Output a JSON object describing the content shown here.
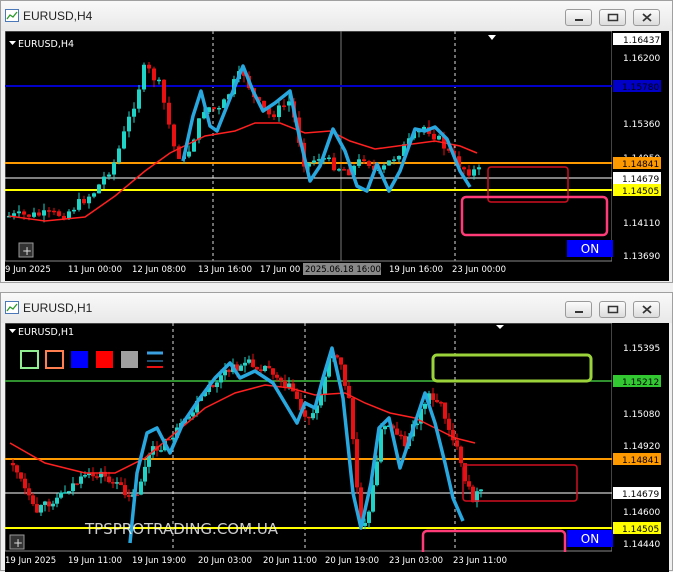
{
  "windows": [
    {
      "title": "EURUSD,H4",
      "symbol_label": "EURUSD,H4",
      "price_labels": [
        "1.16437",
        "1.16200",
        "1.15360",
        "1.14950",
        "1.14110",
        "1.13690"
      ],
      "highlight_labels": [
        {
          "text": "1.14841",
          "bg": "#ff9900",
          "color": "#000000"
        },
        {
          "text": "1.14679",
          "bg": "#ffffff",
          "color": "#000000"
        },
        {
          "text": "1.14505",
          "bg": "#ffff00",
          "color": "#000000"
        },
        {
          "text": "1.15780",
          "bg": "#0000c8",
          "color": "#000000"
        }
      ],
      "time_labels": [
        "9 Jun 2025",
        "11 Jun 00:00",
        "12 Jun 08:00",
        "13 Jun 16:00",
        "17 Jun 00",
        "2025.06.18 16:00",
        "19 Jun 16:00",
        "23 Jun 00:00"
      ],
      "on_button": "ON"
    },
    {
      "title": "EURUSD,H1",
      "symbol_label": "EURUSD,H1",
      "price_labels": [
        "1.15395",
        "1.15080",
        "1.14920",
        "1.14600",
        "1.14440"
      ],
      "highlight_labels": [
        {
          "text": "1.15212",
          "bg": "#32c832",
          "color": "#000000"
        },
        {
          "text": "1.14841",
          "bg": "#ff9900",
          "color": "#000000"
        },
        {
          "text": "1.14679",
          "bg": "#ffffff",
          "color": "#000000"
        },
        {
          "text": "1.14505",
          "bg": "#ffff00",
          "color": "#000000"
        }
      ],
      "time_labels": [
        "19 Jun 2025",
        "19 Jun 11:00",
        "19 Jun 19:00",
        "20 Jun 03:00",
        "20 Jun 11:00",
        "20 Jun 19:00",
        "23 Jun 03:00",
        "23 Jun 11:00"
      ],
      "watermark": "TPSPROTRADING.COM.UA",
      "on_button": "ON",
      "palette": [
        "#90ee90",
        "#ff7f50",
        "#0000ff",
        "#ff0000",
        "#a0a0a0"
      ]
    }
  ],
  "colors": {
    "bull": "#1fd3c6",
    "bear": "#e81010",
    "wave": "#29a8e0",
    "ma": "#ff2020",
    "orange": "#ff9900",
    "yellow": "#ffff00",
    "blue": "#0000c8",
    "green": "#40c040",
    "pink": "#ff3c78"
  }
}
